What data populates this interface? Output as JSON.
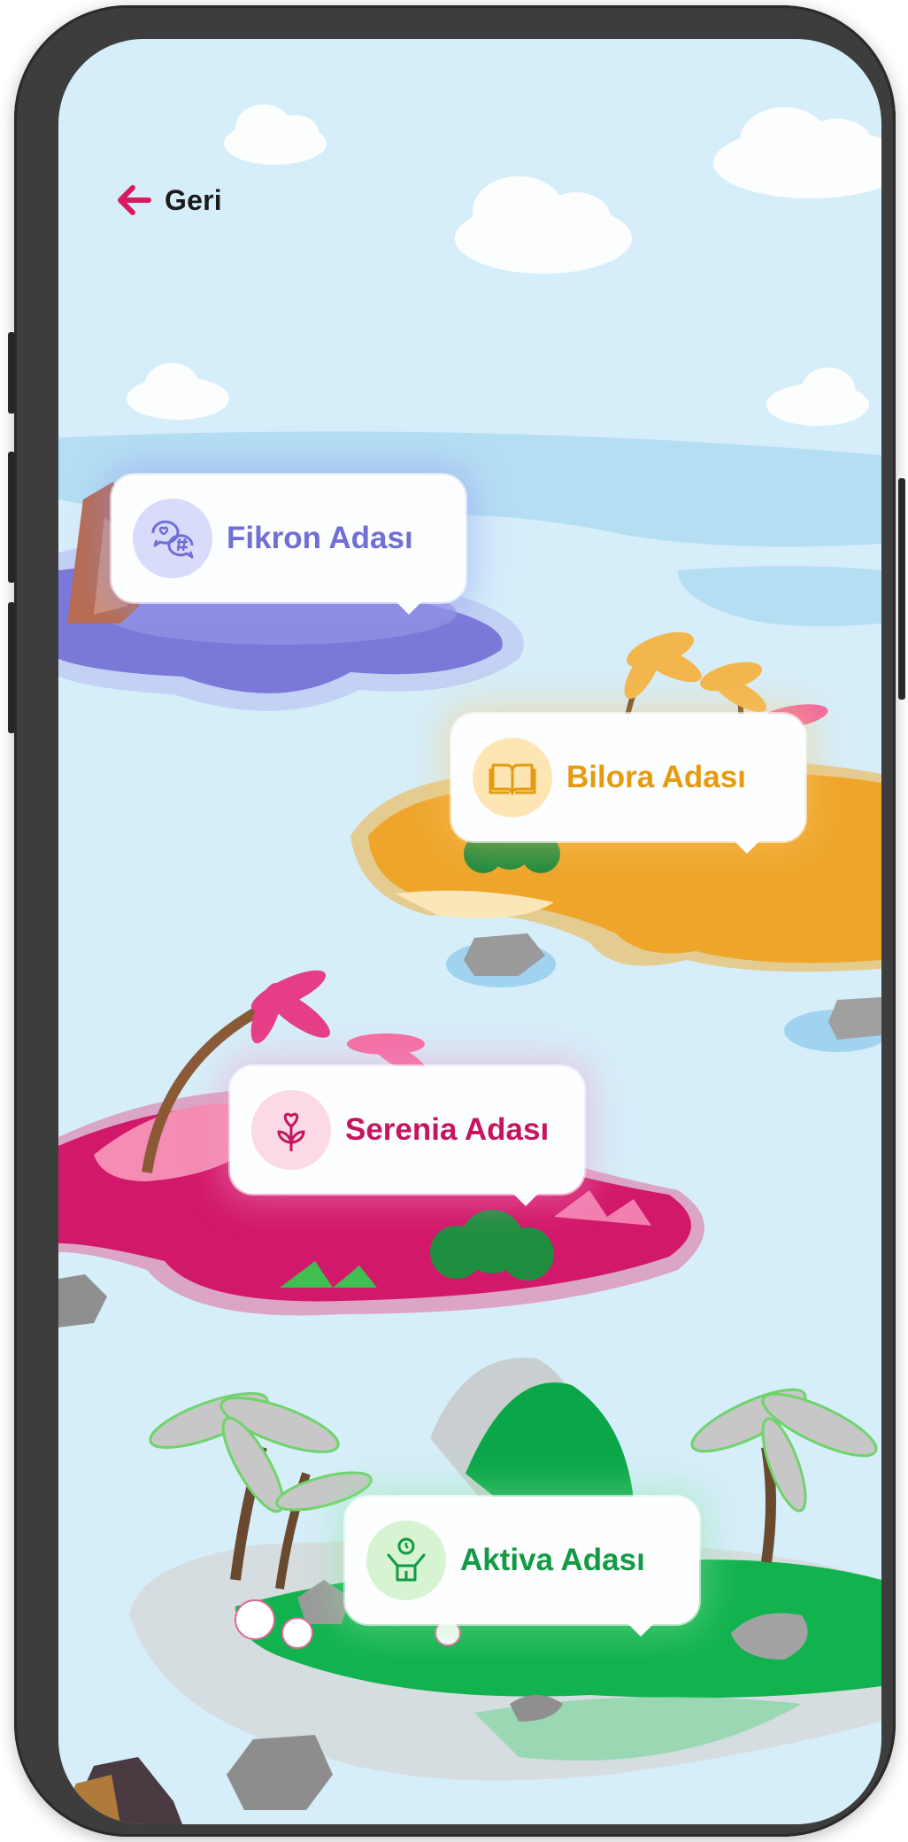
{
  "nav": {
    "back_label": "Geri"
  },
  "islands": [
    {
      "name": "Fikron Adası",
      "icon": "chat-hashtag-icon",
      "color": "#6f6fd6",
      "badge_bg": "#d9dbfb",
      "glow": "rgba(140,150,240,0.45)"
    },
    {
      "name": "Bilora Adası",
      "icon": "open-book-icon",
      "color": "#e59b10",
      "badge_bg": "#fde6b4",
      "glow": "rgba(250,200,110,0.45)"
    },
    {
      "name": "Serenia Adası",
      "icon": "heart-flower-icon",
      "color": "#c5155e",
      "badge_bg": "#fbd9e7",
      "glow": "rgba(240,150,200,0.45)"
    },
    {
      "name": "Aktiva Adası",
      "icon": "person-activity-icon",
      "color": "#139a45",
      "badge_bg": "#d6f3d2",
      "glow": "rgba(140,230,160,0.45)"
    }
  ],
  "colors": {
    "sky": "#d6eefa",
    "water": "#b5def3",
    "accent_back": "#d81b60"
  }
}
